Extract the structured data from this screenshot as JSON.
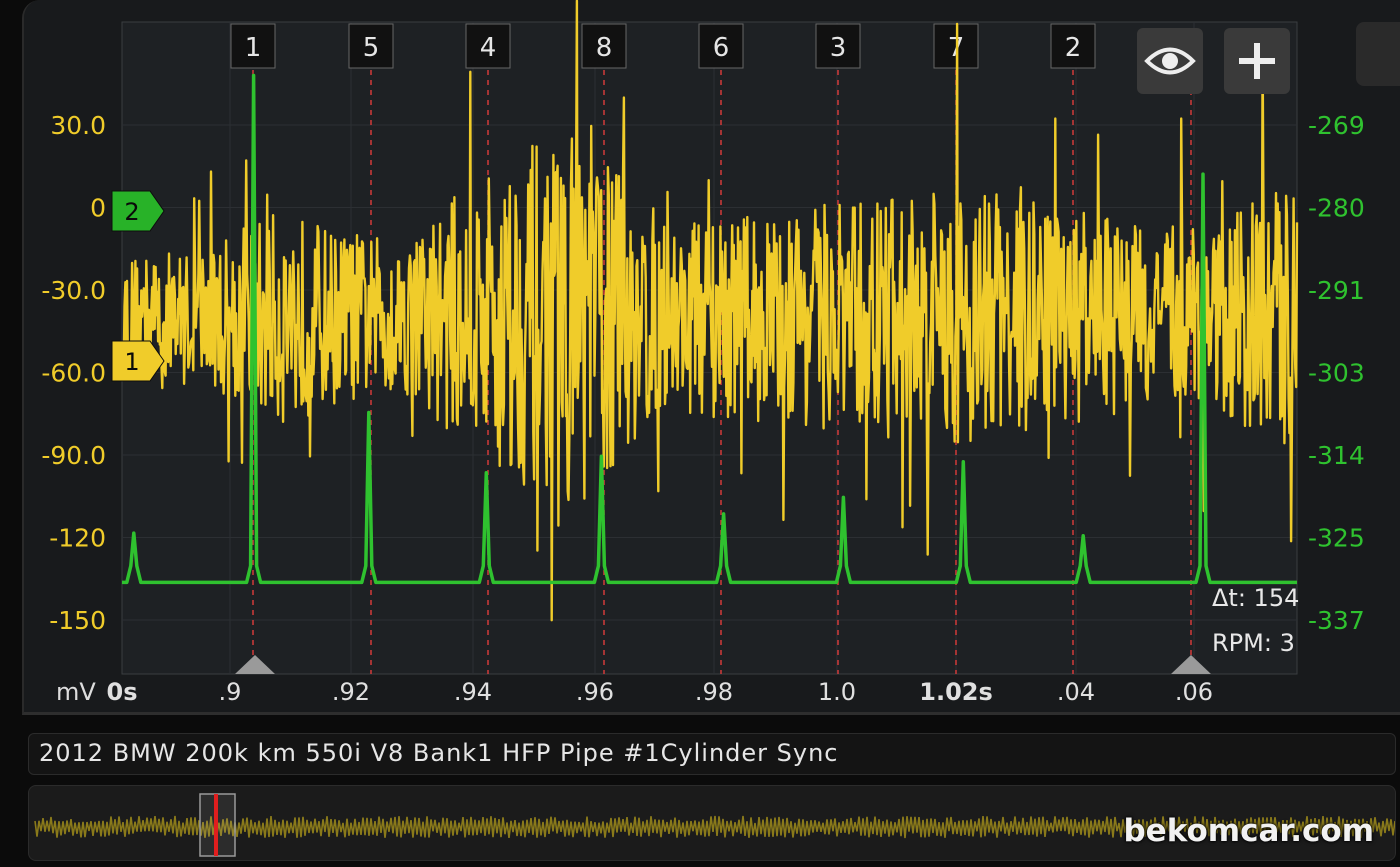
{
  "title": "2012 BMW 200k km 550i V8 Bank1 HFP Pipe #1Cylinder Sync",
  "watermark": "bekomcar.com",
  "toolbar": {
    "eye_icon": "eye-icon",
    "add_icon": "plus-icon"
  },
  "readouts": {
    "delta_t": "Δt: 154",
    "rpm": "RPM: 3"
  },
  "chart_data": {
    "type": "line",
    "x_unit_label": "mV",
    "x_ticks": [
      "0s",
      ".9",
      ".92",
      ".94",
      ".96",
      ".98",
      "1.0",
      "1.02s",
      ".04",
      ".06"
    ],
    "y_left_ticks": [
      "30.0",
      "0",
      "-30.0",
      "-60.0",
      "-90.0",
      "-120",
      "-150"
    ],
    "y_right_ticks": [
      "-269",
      "-280",
      "-291",
      "-303",
      "-314",
      "-325",
      "-337"
    ],
    "channel_markers": [
      "2",
      "1"
    ],
    "firing_order": [
      "1",
      "5",
      "4",
      "8",
      "6",
      "3",
      "7",
      "2"
    ],
    "colors": {
      "ch1": "#f0cc2a",
      "ch2": "#2fc22f",
      "cylinder_line": "#d23a3a",
      "grid": "#2c2f33"
    },
    "series": [
      {
        "name": "1",
        "y_axis": "left",
        "style": "noisy pressure waveform",
        "baseline": -40,
        "envelope": [
          {
            "t": 0.0,
            "amp": 22
          },
          {
            "t": 0.03,
            "amp": 25
          },
          {
            "t": 0.07,
            "amp": 40
          },
          {
            "t": 0.09,
            "amp": 32
          },
          {
            "t": 0.12,
            "amp": 28
          },
          {
            "t": 0.16,
            "amp": 58
          },
          {
            "t": 0.2,
            "amp": 70
          },
          {
            "t": 0.23,
            "amp": 35
          },
          {
            "t": 0.29,
            "amp": 40
          },
          {
            "t": 0.36,
            "amp": 48
          },
          {
            "t": 0.4,
            "amp": 40
          },
          {
            "t": 0.44,
            "amp": 32
          },
          {
            "t": 0.47,
            "amp": 36
          },
          {
            "t": 0.5,
            "amp": 52
          }
        ]
      },
      {
        "name": "2",
        "y_axis": "left",
        "style": "spike train",
        "baseline": -137,
        "spikes": [
          {
            "t": 0.005,
            "peak": -119
          },
          {
            "t": 0.056,
            "peak": 48
          },
          {
            "t": 0.105,
            "peak": -75
          },
          {
            "t": 0.155,
            "peak": -97
          },
          {
            "t": 0.204,
            "peak": -91
          },
          {
            "t": 0.256,
            "peak": -112
          },
          {
            "t": 0.307,
            "peak": -106
          },
          {
            "t": 0.358,
            "peak": -93
          },
          {
            "t": 0.409,
            "peak": -120
          },
          {
            "t": 0.46,
            "peak": 12
          }
        ]
      }
    ]
  }
}
